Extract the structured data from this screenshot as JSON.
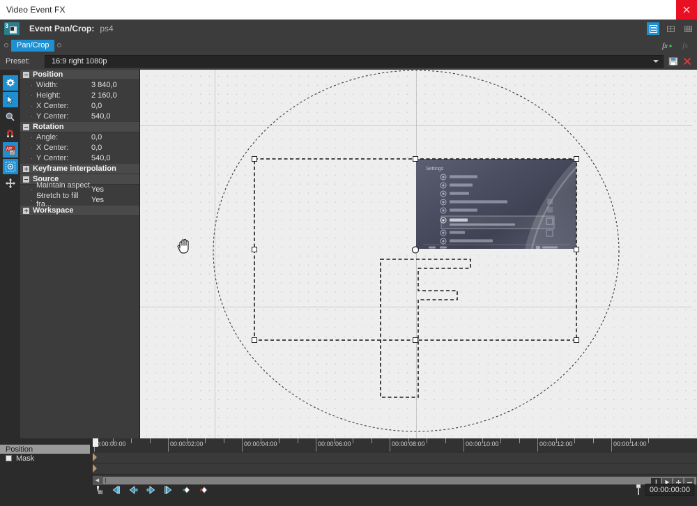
{
  "window": {
    "title": "Video Event FX",
    "close_label": "×"
  },
  "fx_header": {
    "plugin_badge": "3",
    "title": "Event Pan/Crop:",
    "event_name": "ps4",
    "buttons": [
      {
        "name": "properties-view",
        "label": "",
        "active": true
      },
      {
        "name": "grid-view-2",
        "label": "",
        "active": false
      },
      {
        "name": "grid-view-3",
        "label": "",
        "active": false
      }
    ]
  },
  "chain": {
    "node_label": "Pan/Crop",
    "fx_add_label": "fx+",
    "fx_remove_label": "fx-"
  },
  "preset": {
    "label": "Preset:",
    "value": "16:9 right 1080p",
    "save_title": "Save Preset",
    "delete_title": "Delete Preset"
  },
  "tools": [
    {
      "name": "tool-settings",
      "icon": "gear-icon",
      "selected": true
    },
    {
      "name": "tool-normal-edit",
      "icon": "arrow-cursor-icon",
      "selected": true
    },
    {
      "name": "tool-zoom-edit",
      "icon": "magnifier-icon",
      "selected": false
    },
    {
      "name": "tool-enable-snapping",
      "icon": "magnet-icon",
      "selected": false
    },
    {
      "name": "tool-lock-aspect-ratio",
      "icon": "aspect-lock-icon",
      "selected": true
    },
    {
      "name": "tool-size-about-center",
      "icon": "size-center-icon",
      "selected": true
    },
    {
      "name": "tool-move-freely",
      "icon": "move-arrows-icon",
      "selected": false
    }
  ],
  "params": {
    "groups": [
      {
        "name": "position",
        "label": "Position",
        "expanded": true,
        "rows": [
          {
            "label": "Width:",
            "value": "3 840,0"
          },
          {
            "label": "Height:",
            "value": "2 160,0"
          },
          {
            "label": "X Center:",
            "value": "0,0"
          },
          {
            "label": "Y Center:",
            "value": "540,0"
          }
        ]
      },
      {
        "name": "rotation",
        "label": "Rotation",
        "expanded": true,
        "rows": [
          {
            "label": "Angle:",
            "value": "0,0"
          },
          {
            "label": "X Center:",
            "value": "0,0"
          },
          {
            "label": "Y Center:",
            "value": "540,0"
          }
        ]
      },
      {
        "name": "keyframe-interpolation",
        "label": "Keyframe interpolation",
        "expanded": false,
        "rows": []
      },
      {
        "name": "source",
        "label": "Source",
        "expanded": true,
        "rows": [
          {
            "label": "Maintain aspect ...",
            "value": "Yes"
          },
          {
            "label": "Stretch to fill fra...",
            "value": "Yes"
          }
        ]
      },
      {
        "name": "workspace",
        "label": "Workspace",
        "expanded": false,
        "rows": []
      }
    ]
  },
  "canvas": {
    "cursor": "pan-hand-cursor",
    "media_title": "Settings",
    "media_menu_items": [
      "Users and Accounts",
      "Parental Controls",
      "Themes",
      "Notifications",
      "Devices",
      "Network",
      "Sound and Screen",
      "System",
      "Initialization"
    ],
    "media_highlighted_item": "Remote Play Connection Settings",
    "media_footer_left": "Back",
    "media_footer_right": "Enter"
  },
  "timeline": {
    "key_rows": [
      {
        "name": "position",
        "label": "Position",
        "selected": true,
        "has_checkbox": false
      },
      {
        "name": "mask",
        "label": "Mask",
        "selected": false,
        "has_checkbox": true
      }
    ],
    "ruler_labels": [
      "0:00:00:00",
      "00:00:02:00",
      "00:00:04:00",
      "00:00:06:00",
      "00:00:08:00",
      "00:00:10:00",
      "00:00:12:00",
      "00:00:14:00"
    ],
    "keyframe_buttons": [
      {
        "name": "lock-keyframes-button",
        "icon": "lock-keyframe-icon"
      },
      {
        "name": "first-keyframe-button",
        "icon": "skip-first-icon"
      },
      {
        "name": "previous-keyframe-button",
        "icon": "step-back-icon"
      },
      {
        "name": "next-keyframe-button",
        "icon": "step-forward-icon"
      },
      {
        "name": "last-keyframe-button",
        "icon": "skip-last-icon"
      },
      {
        "name": "create-keyframe-button",
        "icon": "add-keyframe-icon"
      },
      {
        "name": "delete-keyframe-button",
        "icon": "delete-keyframe-icon"
      }
    ],
    "transport": [
      {
        "name": "pause-button",
        "icon": "pause-icon"
      },
      {
        "name": "play-button",
        "icon": "play-icon"
      },
      {
        "name": "zoom-in-button",
        "icon": "plus-icon"
      },
      {
        "name": "zoom-out-button",
        "icon": "minus-icon"
      }
    ],
    "timecode": "00:00:00:00",
    "scroll_left_label": "◀",
    "scroll_right_label": "▶"
  },
  "colors": {
    "accent": "#1e90d2",
    "panel": "#3c3c3c",
    "group_header": "#4a4a4a",
    "canvas_bg": "#eeeeee",
    "close_red": "#e81123"
  }
}
